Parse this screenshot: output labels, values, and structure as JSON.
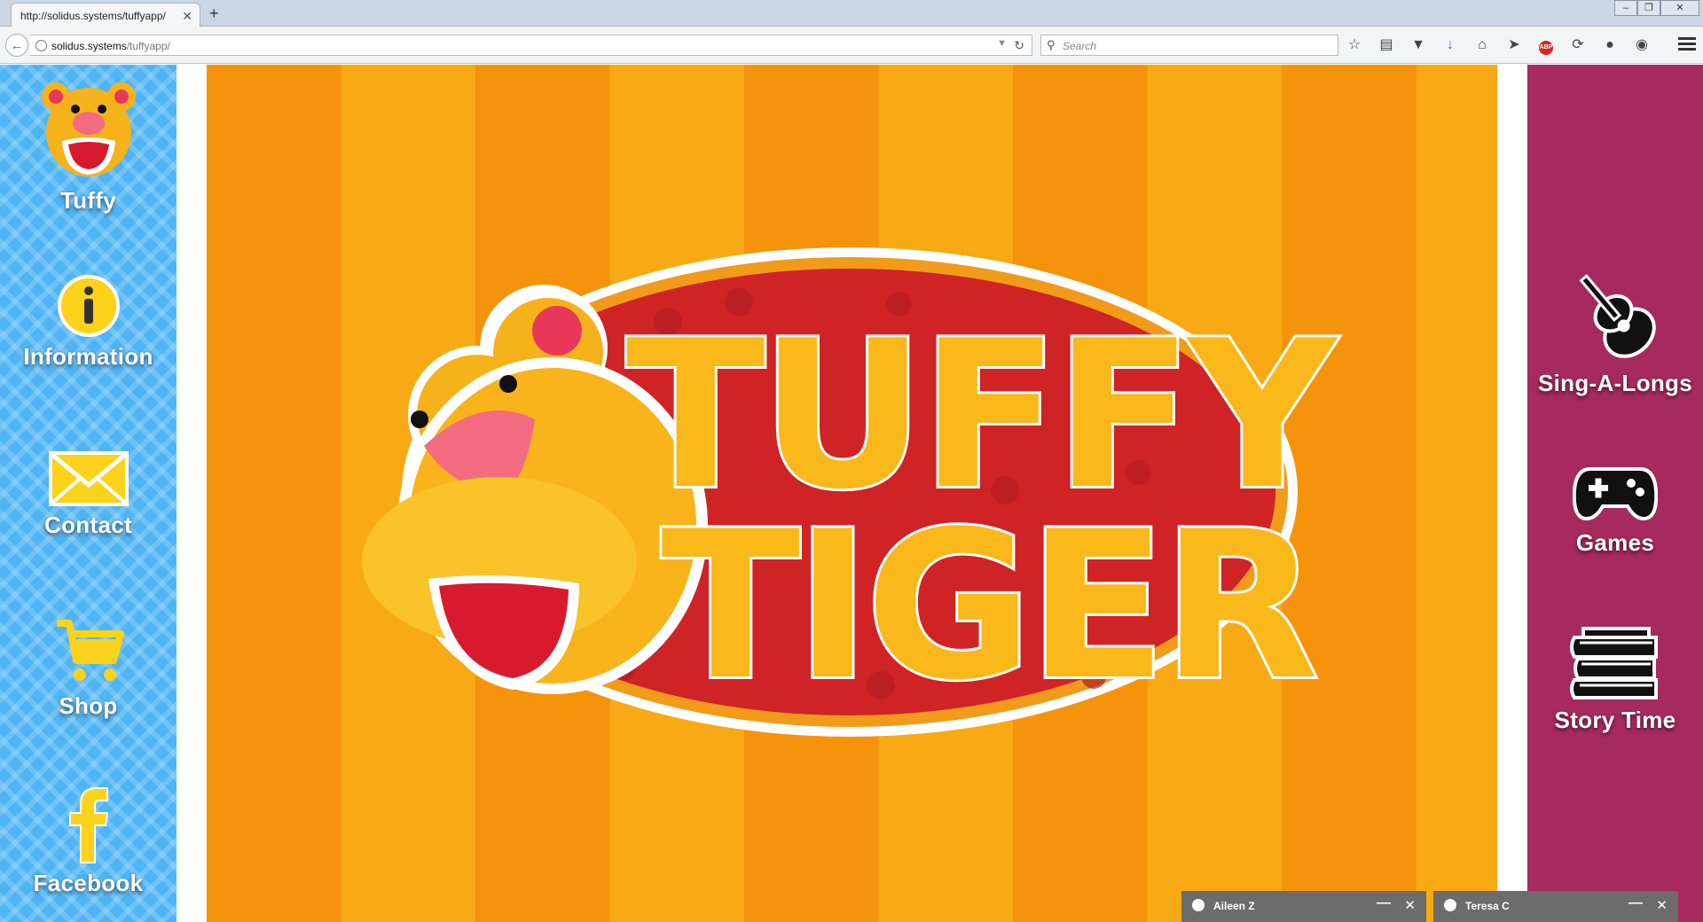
{
  "browser": {
    "tab_title": "http://solidus.systems/tuffyapp/",
    "url_host": "solidus.systems",
    "url_path": "/tuffyapp/",
    "search_placeholder": "Search",
    "new_tab_label": "+",
    "tab_close_label": "✕",
    "toolbar_icons": [
      "star-icon",
      "reading-list-icon",
      "pocket-icon",
      "download-icon",
      "home-icon",
      "send-icon",
      "adblock-icon",
      "history-icon",
      "chat-icon",
      "privacy-icon",
      "menu-icon"
    ],
    "adblock_label": "ABP"
  },
  "left_nav": [
    {
      "label": "Tuffy",
      "icon": "tiger-face-icon"
    },
    {
      "label": "Information",
      "icon": "info-icon"
    },
    {
      "label": "Contact",
      "icon": "envelope-icon"
    },
    {
      "label": "Shop",
      "icon": "shopping-cart-icon"
    },
    {
      "label": "Facebook",
      "icon": "facebook-icon"
    }
  ],
  "right_nav": [
    {
      "label": "Sing-A-Longs",
      "icon": "guitar-icon"
    },
    {
      "label": "Games",
      "icon": "gamepad-icon"
    },
    {
      "label": "Story Time",
      "icon": "books-icon"
    }
  ],
  "hero": {
    "logo_line1": "TUFFY",
    "logo_line2": "TIGER"
  },
  "chats": [
    {
      "name": "Aileen Z",
      "minimize": "—",
      "close": "✕"
    },
    {
      "name": "Teresa C",
      "minimize": "—",
      "close": "✕"
    }
  ],
  "colors": {
    "left_sidebar": "#4fb4f3",
    "right_sidebar": "#a62a5e",
    "stripe_dark": "#f5930b",
    "stripe_light": "#f9a913",
    "logo_oval": "#cc2222",
    "logo_text": "#fbb81a"
  }
}
